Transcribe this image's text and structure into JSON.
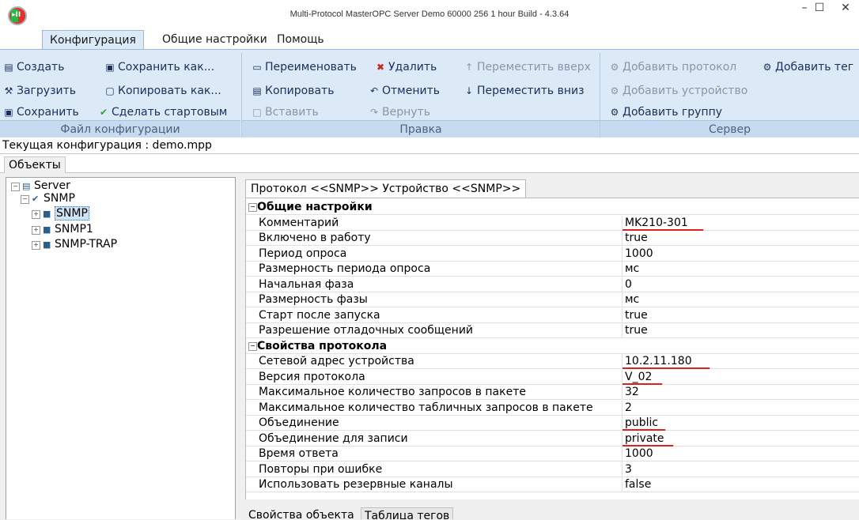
{
  "window": {
    "title": "Multi-Protocol MasterOPC Server Demo 60000 256 1 hour Build - 4.3.64",
    "app_icon_text": "▸II",
    "minimize": "–",
    "maximize": "☐",
    "close": "✕"
  },
  "menu": {
    "tabs": [
      "Конфигурация",
      "Общие настройки",
      "Помощь"
    ]
  },
  "ribbon": {
    "file": {
      "label": "Файл конфигурации",
      "items": [
        {
          "label": "Создать",
          "icon": "new-file-icon",
          "glyph": "▤"
        },
        {
          "label": "Загрузить",
          "icon": "load-icon",
          "glyph": "⚒"
        },
        {
          "label": "Сохранить",
          "icon": "save-icon",
          "glyph": "▣"
        },
        {
          "label": "Сохранить как...",
          "icon": "save-as-icon",
          "glyph": "▣"
        },
        {
          "label": "Копировать как...",
          "icon": "copy-as-icon",
          "glyph": "▢"
        },
        {
          "label": "Сделать стартовым",
          "icon": "check-icon",
          "glyph": "✔"
        }
      ]
    },
    "edit": {
      "label": "Правка",
      "items": [
        {
          "label": "Переименовать",
          "icon": "rename-icon",
          "glyph": "▭"
        },
        {
          "label": "Копировать",
          "icon": "copy-icon",
          "glyph": "▤"
        },
        {
          "label": "Вставить",
          "icon": "paste-icon",
          "glyph": "□"
        },
        {
          "label": "Удалить",
          "icon": "delete-icon",
          "glyph": "✖"
        },
        {
          "label": "Отменить",
          "icon": "undo-icon",
          "glyph": "↶"
        },
        {
          "label": "Вернуть",
          "icon": "redo-icon",
          "glyph": "↷"
        },
        {
          "label": "Переместить вверх",
          "icon": "move-up-icon",
          "glyph": "↑"
        },
        {
          "label": "Переместить вниз",
          "icon": "move-down-icon",
          "glyph": "↓"
        }
      ]
    },
    "server": {
      "label": "Сервер",
      "items": [
        {
          "label": "Добавить протокол",
          "icon": "add-protocol-icon",
          "glyph": "⚙"
        },
        {
          "label": "Добавить устройство",
          "icon": "add-device-icon",
          "glyph": "⚙"
        },
        {
          "label": "Добавить группу",
          "icon": "add-group-icon",
          "glyph": "⚙"
        },
        {
          "label": "Добавить тег",
          "icon": "add-tag-icon",
          "glyph": "⚙"
        }
      ]
    }
  },
  "current_config": "Текущая конфигурация : demo.mpp",
  "objects_tab": "Объекты",
  "tree": [
    {
      "label": "Server",
      "level": 0,
      "pm": "−"
    },
    {
      "label": "SNMP",
      "level": 1,
      "pm": "−"
    },
    {
      "label": "SNMP",
      "level": 2,
      "pm": "+",
      "selected": true
    },
    {
      "label": "SNMP1",
      "level": 2,
      "pm": "+"
    },
    {
      "label": "SNMP-TRAP",
      "level": 2,
      "pm": "+"
    }
  ],
  "property_tab": "Протокол <<SNMP>> Устройство <<SNMP>>",
  "properties": [
    {
      "name": "Общие настройки",
      "category": true
    },
    {
      "name": "Комментарий",
      "value": "MK210-301",
      "underline": true
    },
    {
      "name": "Включено в работу",
      "value": "true"
    },
    {
      "name": "Период опроса",
      "value": "1000"
    },
    {
      "name": "Размерность периода опроса",
      "value": "мс"
    },
    {
      "name": "Начальная фаза",
      "value": "0"
    },
    {
      "name": "Размерность фазы",
      "value": "мс"
    },
    {
      "name": "Старт после запуска",
      "value": "true"
    },
    {
      "name": "Разрешение отладочных сообщений",
      "value": "true"
    },
    {
      "name": "Свойства протокола",
      "category": true
    },
    {
      "name": "Сетевой адрес устройства",
      "value": "10.2.11.180",
      "underline": true
    },
    {
      "name": "Версия протокола",
      "value": "V_02",
      "underline": true
    },
    {
      "name": "Максимальное количество запросов в пакете",
      "value": "32"
    },
    {
      "name": "Максимальное количество табличных запросов в пакете",
      "value": "2"
    },
    {
      "name": "Объединение",
      "value": "public",
      "underline": true
    },
    {
      "name": "Объединение для записи",
      "value": "private",
      "underline": true
    },
    {
      "name": "Время ответа",
      "value": "1000"
    },
    {
      "name": "Повторы при ошибке",
      "value": "3"
    },
    {
      "name": "Использовать резервные каналы",
      "value": "false"
    }
  ],
  "bottom_tabs": [
    "Свойства объекта",
    "Таблица тегов"
  ],
  "colors": {
    "ribbon_bg": "#dce9f7",
    "underline": "#e02020",
    "selection": "#cfe3f7"
  }
}
